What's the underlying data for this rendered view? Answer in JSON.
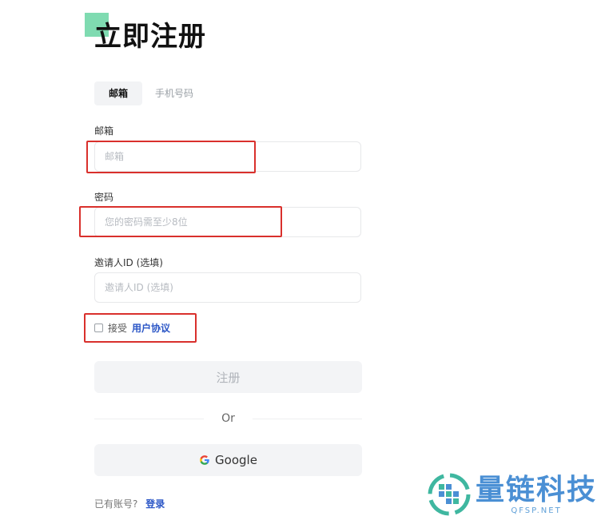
{
  "page": {
    "title": "立即注册"
  },
  "tabs": [
    {
      "label": "邮箱",
      "active": true
    },
    {
      "label": "手机号码",
      "active": false
    }
  ],
  "form": {
    "email": {
      "label": "邮箱",
      "placeholder": "邮箱",
      "value": ""
    },
    "password": {
      "label": "密码",
      "placeholder": "您的密码需至少8位",
      "value": ""
    },
    "referral": {
      "label": "邀请人ID (选填)",
      "placeholder": "邀请人ID (选填)",
      "value": ""
    },
    "agree": {
      "checked": false,
      "prefix": "接受",
      "link_label": "用户协议"
    }
  },
  "actions": {
    "register_label": "注册",
    "divider_label": "Or",
    "google_label": "Google"
  },
  "login": {
    "prompt": "已有账号?",
    "link_label": "登录"
  },
  "watermark": {
    "brand_cn": "量链科技",
    "brand_en": "QFSP.NET"
  },
  "colors": {
    "accent_green": "#7fdbb1",
    "highlight_red": "#d9302c",
    "link_blue": "#2b56c6"
  }
}
